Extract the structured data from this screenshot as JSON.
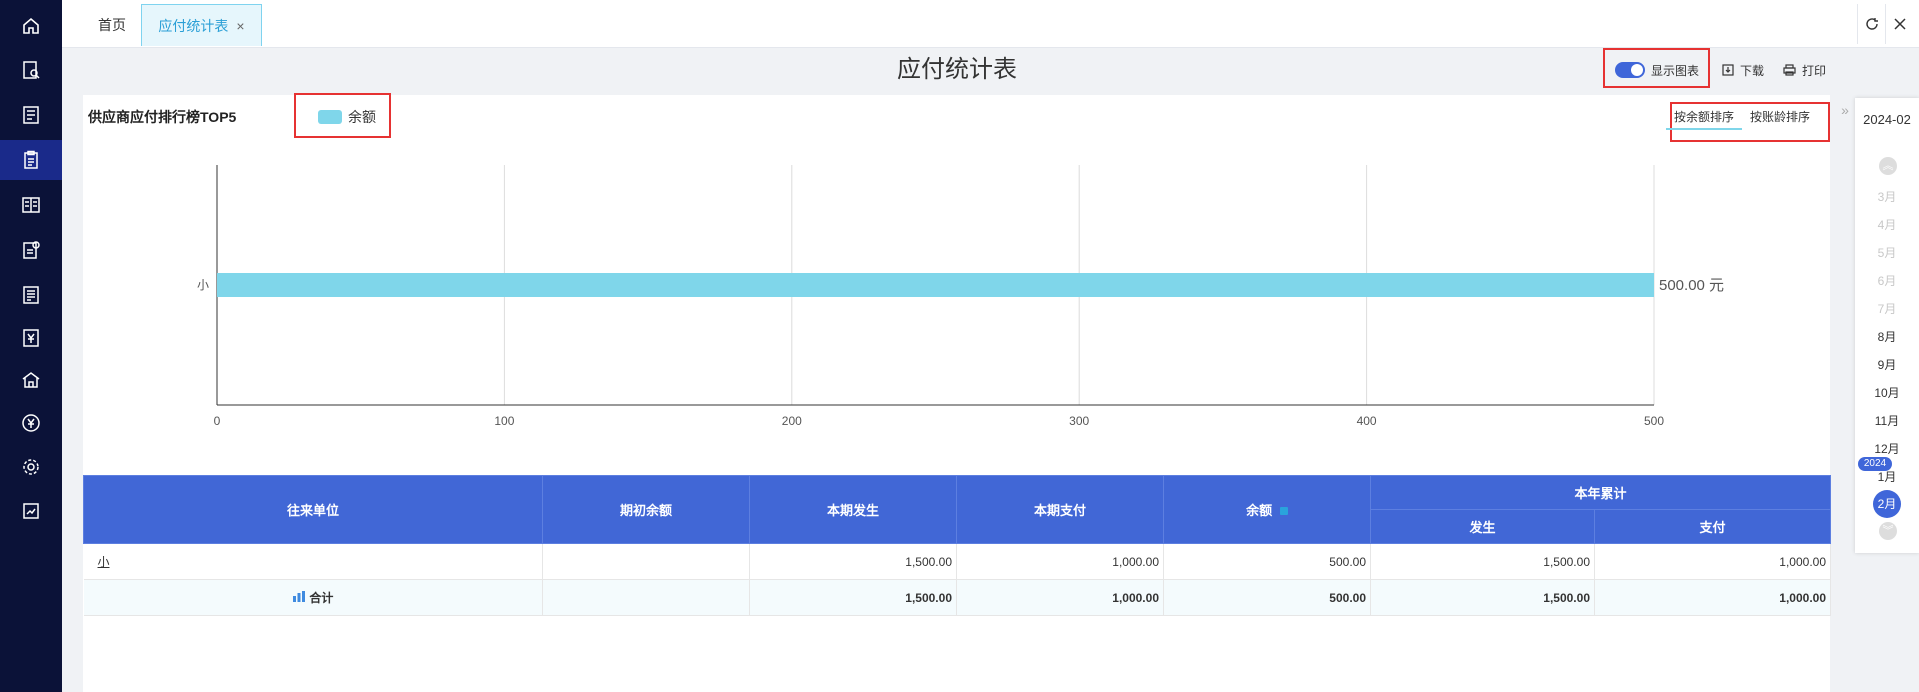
{
  "nav": {
    "items": [
      {
        "icon": "home-icon"
      },
      {
        "icon": "search-document-icon"
      },
      {
        "icon": "list-document-icon"
      },
      {
        "icon": "clipboard-icon"
      },
      {
        "icon": "ledger-icon"
      },
      {
        "icon": "document-settings-icon"
      },
      {
        "icon": "report-icon"
      },
      {
        "icon": "yen-document-icon"
      },
      {
        "icon": "building-icon"
      },
      {
        "icon": "yen-circle-icon"
      },
      {
        "icon": "gear-icon"
      },
      {
        "icon": "chart-document-icon"
      }
    ]
  },
  "tabs": {
    "home": "首页",
    "active": "应付统计表",
    "close": "×"
  },
  "title": "应付统计表",
  "toolbar": {
    "show_chart": "显示图表",
    "download": "下载",
    "print": "打印"
  },
  "chart_panel": {
    "title": "供应商应付排行榜TOP5",
    "legend": "余额",
    "sort_by_balance": "按余额排序",
    "sort_by_age": "按账龄排序"
  },
  "chart_data": {
    "type": "bar",
    "orientation": "horizontal",
    "categories": [
      "小"
    ],
    "series": [
      {
        "name": "余额",
        "values": [
          500
        ]
      }
    ],
    "value_labels": [
      "500.00 元"
    ],
    "xlim": [
      0,
      500
    ],
    "xticks": [
      "0",
      "100",
      "200",
      "300",
      "400",
      "500"
    ],
    "grid": true,
    "bar_color": "#7fd6ea"
  },
  "table": {
    "headers": {
      "unit": "往来单位",
      "opening": "期初余额",
      "current_occur": "本期发生",
      "current_pay": "本期支付",
      "balance": "余额",
      "ytd": "本年累计",
      "ytd_occur": "发生",
      "ytd_pay": "支付"
    },
    "rows": [
      {
        "unit": "小",
        "opening": "",
        "current_occur": "1,500.00",
        "current_pay": "1,000.00",
        "balance": "500.00",
        "ytd_occur": "1,500.00",
        "ytd_pay": "1,000.00"
      }
    ],
    "total": {
      "unit": "合计",
      "opening": "",
      "current_occur": "1,500.00",
      "current_pay": "1,000.00",
      "balance": "500.00",
      "ytd_occur": "1,500.00",
      "ytd_pay": "1,000.00"
    }
  },
  "datepicker": {
    "current": "2024-02",
    "months_dim": [
      "3月",
      "4月",
      "5月",
      "6月",
      "7月"
    ],
    "months": [
      "8月",
      "9月",
      "10月",
      "11月",
      "12月",
      "1月"
    ],
    "year_badge": "2024",
    "selected": "2月",
    "collapse": "»"
  }
}
